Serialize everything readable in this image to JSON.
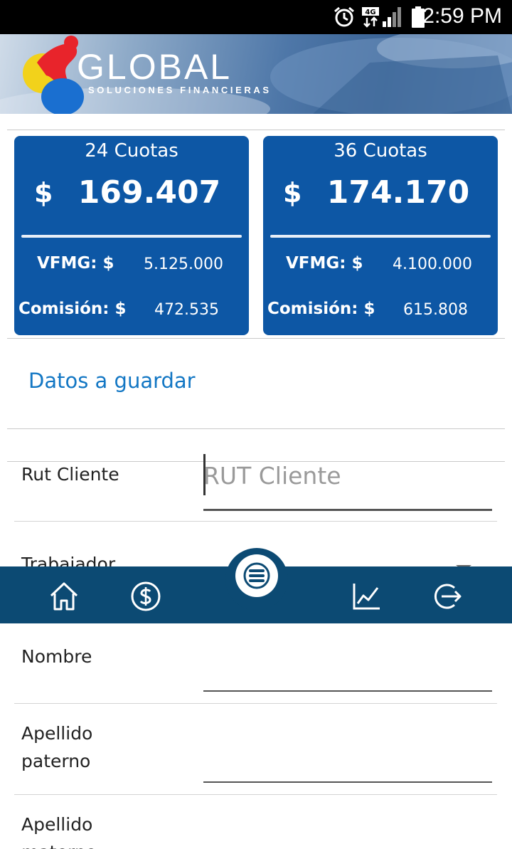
{
  "status_bar": {
    "time": "2:59 PM",
    "network": "4G"
  },
  "header": {
    "brand": "GLOBAL",
    "tagline": "SOLUCIONES FINANCIERAS"
  },
  "cards": [
    {
      "cuotas": "24 Cuotas",
      "currency": "$",
      "amount": "169.407",
      "vfmg_label": "VFMG: $",
      "vfmg_value": "5.125.000",
      "comision_label": "Comisión: $",
      "comision_value": "472.535"
    },
    {
      "cuotas": "36 Cuotas",
      "currency": "$",
      "amount": "174.170",
      "vfmg_label": "VFMG: $",
      "vfmg_value": "4.100.000",
      "comision_label": "Comisión: $",
      "comision_value": "615.808"
    }
  ],
  "section": {
    "title": "Datos a guardar"
  },
  "form": {
    "rut_label": "Rut Cliente",
    "rut_placeholder": "RUT Cliente",
    "trabajador_label": "Trabajador",
    "nombre_label": "Nombre",
    "apellido_paterno_label": "Apellido paterno",
    "apellido_materno_label": "Apellido materno"
  },
  "bottom_nav": {
    "items": [
      "home-icon",
      "dollar-icon",
      "menu-icon",
      "chart-icon",
      "logout-icon"
    ]
  },
  "colors": {
    "card_blue": "#0d57a5",
    "nav_blue": "#0c4a73",
    "accent_blue": "#1377c4"
  }
}
